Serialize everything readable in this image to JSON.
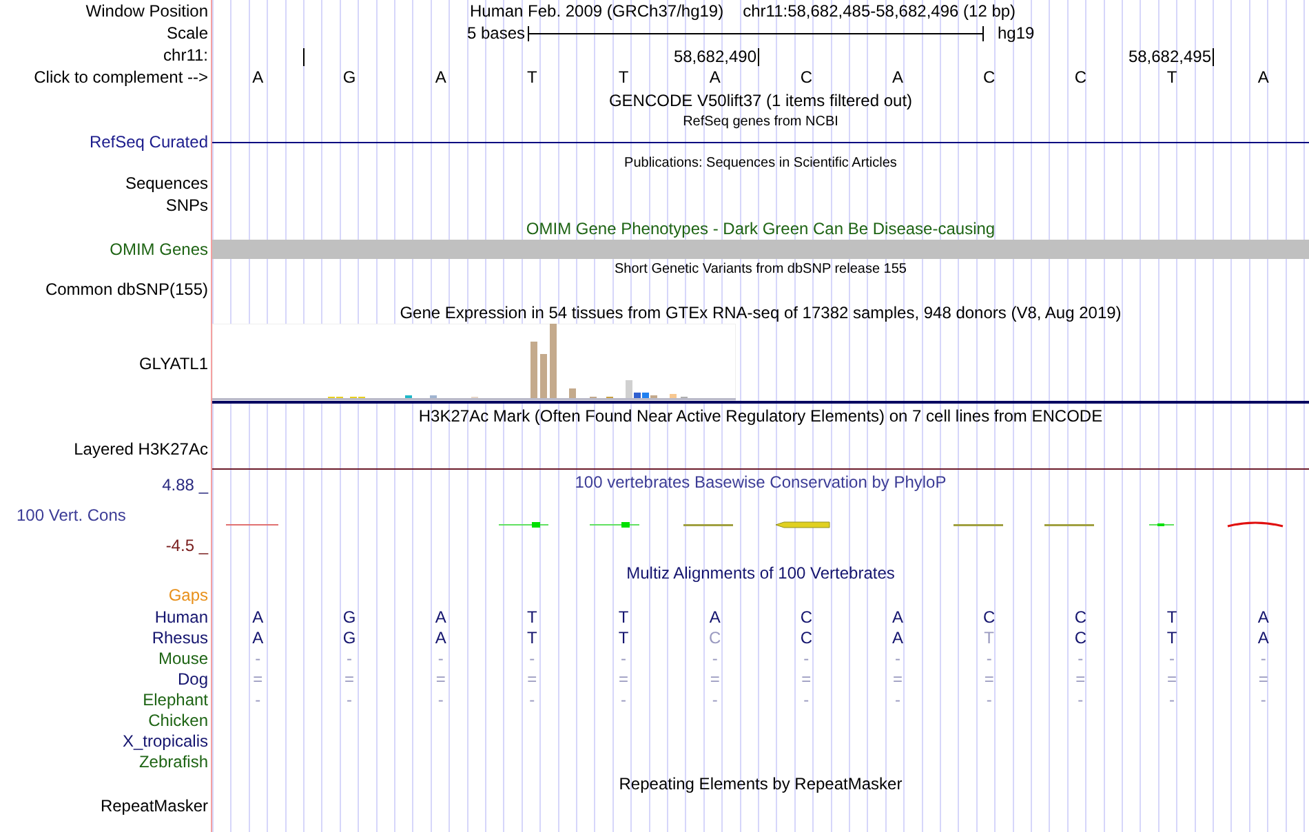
{
  "header": {
    "window_position_label": "Window Position",
    "assembly": "Human Feb. 2009 (GRCh37/hg19)",
    "position": "chr11:58,682,485-58,682,496 (12 bp)",
    "scale_label": "Scale",
    "scale_text": "5 bases",
    "scale_assembly": "hg19",
    "chrom_label": "chr11:",
    "ticks": [
      "58,682,490",
      "58,682,495"
    ],
    "complement_label": "Click to complement -->",
    "bases": [
      "A",
      "G",
      "A",
      "T",
      "T",
      "A",
      "C",
      "A",
      "C",
      "C",
      "T",
      "A"
    ]
  },
  "tracks": [
    {
      "kind": "title",
      "text": "GENCODE V50lift37 (1 items filtered out)",
      "color": "#000000"
    },
    {
      "kind": "subtitle",
      "text": "RefSeq genes from NCBI"
    },
    {
      "kind": "line",
      "label": "RefSeq Curated",
      "color": "#1c1c8c"
    },
    {
      "kind": "subtitle",
      "text": "Publications: Sequences in Scientific Articles"
    },
    {
      "kind": "label",
      "label": "Sequences",
      "color": "#000000"
    },
    {
      "kind": "label",
      "label": "SNPs",
      "color": "#000000"
    },
    {
      "kind": "title",
      "text": "OMIM Gene Phenotypes - Dark Green Can Be Disease-causing",
      "color": "#1e6414"
    },
    {
      "kind": "bar",
      "label": "OMIM Genes",
      "color": "#1e6414"
    },
    {
      "kind": "subtitle",
      "text": "Short Genetic Variants from dbSNP release 155"
    },
    {
      "kind": "label",
      "label": "Common dbSNP(155)",
      "color": "#000000"
    },
    {
      "kind": "title",
      "text": "Gene Expression in 54 tissues from GTEx RNA-seq of 17382 samples, 948 donors (V8, Aug 2019)",
      "color": "#000000"
    },
    {
      "kind": "expression",
      "label": "GLYATL1",
      "color": "#000000"
    },
    {
      "kind": "title",
      "text": "H3K27Ac Mark (Often Found Near Active Regulatory Elements) on 7 cell lines from ENCODE",
      "color": "#000000"
    },
    {
      "kind": "tall",
      "label": "Layered H3K27Ac",
      "color": "#000000"
    },
    {
      "kind": "conservation",
      "title": "100 vertebrates Basewise Conservation by PhyloP",
      "label": "100 Vert. Cons",
      "max": "4.88 _",
      "min": "-4.5 _",
      "color": "#3c3c96"
    },
    {
      "kind": "title",
      "text": "Multiz Alignments of 100 Vertebrates",
      "color": "#14146e"
    },
    {
      "kind": "label",
      "label": "Gaps",
      "color": "#e8901a"
    },
    {
      "kind": "species",
      "label": "Human",
      "color": "#14146e",
      "bases": [
        {
          "b": "A",
          "faded": false
        },
        {
          "b": "G",
          "faded": false
        },
        {
          "b": "A",
          "faded": false
        },
        {
          "b": "T",
          "faded": false
        },
        {
          "b": "T",
          "faded": false
        },
        {
          "b": "A",
          "faded": false
        },
        {
          "b": "C",
          "faded": false
        },
        {
          "b": "A",
          "faded": false
        },
        {
          "b": "C",
          "faded": false
        },
        {
          "b": "C",
          "faded": false
        },
        {
          "b": "T",
          "faded": false
        },
        {
          "b": "A",
          "faded": false
        }
      ]
    },
    {
      "kind": "species",
      "label": "Rhesus",
      "color": "#14146e",
      "bases": [
        {
          "b": "A",
          "faded": false
        },
        {
          "b": "G",
          "faded": false
        },
        {
          "b": "A",
          "faded": false
        },
        {
          "b": "T",
          "faded": false
        },
        {
          "b": "T",
          "faded": false
        },
        {
          "b": "C",
          "faded": true
        },
        {
          "b": "C",
          "faded": false
        },
        {
          "b": "A",
          "faded": false
        },
        {
          "b": "T",
          "faded": true
        },
        {
          "b": "C",
          "faded": false
        },
        {
          "b": "T",
          "faded": false
        },
        {
          "b": "A",
          "faded": false
        }
      ]
    },
    {
      "kind": "species",
      "label": "Mouse",
      "color": "#1e6414",
      "bases": [
        {
          "b": "-",
          "faded": true
        },
        {
          "b": "-",
          "faded": true
        },
        {
          "b": "-",
          "faded": true
        },
        {
          "b": "-",
          "faded": true
        },
        {
          "b": "-",
          "faded": true
        },
        {
          "b": "-",
          "faded": true
        },
        {
          "b": "-",
          "faded": true
        },
        {
          "b": "-",
          "faded": true
        },
        {
          "b": "-",
          "faded": true
        },
        {
          "b": "-",
          "faded": true
        },
        {
          "b": "-",
          "faded": true
        },
        {
          "b": "-",
          "faded": true
        }
      ]
    },
    {
      "kind": "species",
      "label": "Dog",
      "color": "#14146e",
      "bases": [
        {
          "b": "=",
          "faded": true
        },
        {
          "b": "=",
          "faded": true
        },
        {
          "b": "=",
          "faded": true
        },
        {
          "b": "=",
          "faded": true
        },
        {
          "b": "=",
          "faded": true
        },
        {
          "b": "=",
          "faded": true
        },
        {
          "b": "=",
          "faded": true
        },
        {
          "b": "=",
          "faded": true
        },
        {
          "b": "=",
          "faded": true
        },
        {
          "b": "=",
          "faded": true
        },
        {
          "b": "=",
          "faded": true
        },
        {
          "b": "=",
          "faded": true
        }
      ]
    },
    {
      "kind": "species",
      "label": "Elephant",
      "color": "#1e6414",
      "bases": [
        {
          "b": "-",
          "faded": true
        },
        {
          "b": "-",
          "faded": true
        },
        {
          "b": "-",
          "faded": true
        },
        {
          "b": "-",
          "faded": true
        },
        {
          "b": "-",
          "faded": true
        },
        {
          "b": "-",
          "faded": true
        },
        {
          "b": "-",
          "faded": true
        },
        {
          "b": "-",
          "faded": true
        },
        {
          "b": "-",
          "faded": true
        },
        {
          "b": "-",
          "faded": true
        },
        {
          "b": "-",
          "faded": true
        },
        {
          "b": "-",
          "faded": true
        }
      ]
    },
    {
      "kind": "species",
      "label": "Chicken",
      "color": "#1e6414"
    },
    {
      "kind": "species",
      "label": "X_tropicalis",
      "color": "#14146e"
    },
    {
      "kind": "species",
      "label": "Zebrafish",
      "color": "#1e6414"
    },
    {
      "kind": "title",
      "text": "Repeating Elements by RepeatMasker",
      "color": "#000000"
    },
    {
      "kind": "label",
      "label": "RepeatMasker",
      "color": "#000000"
    }
  ]
}
